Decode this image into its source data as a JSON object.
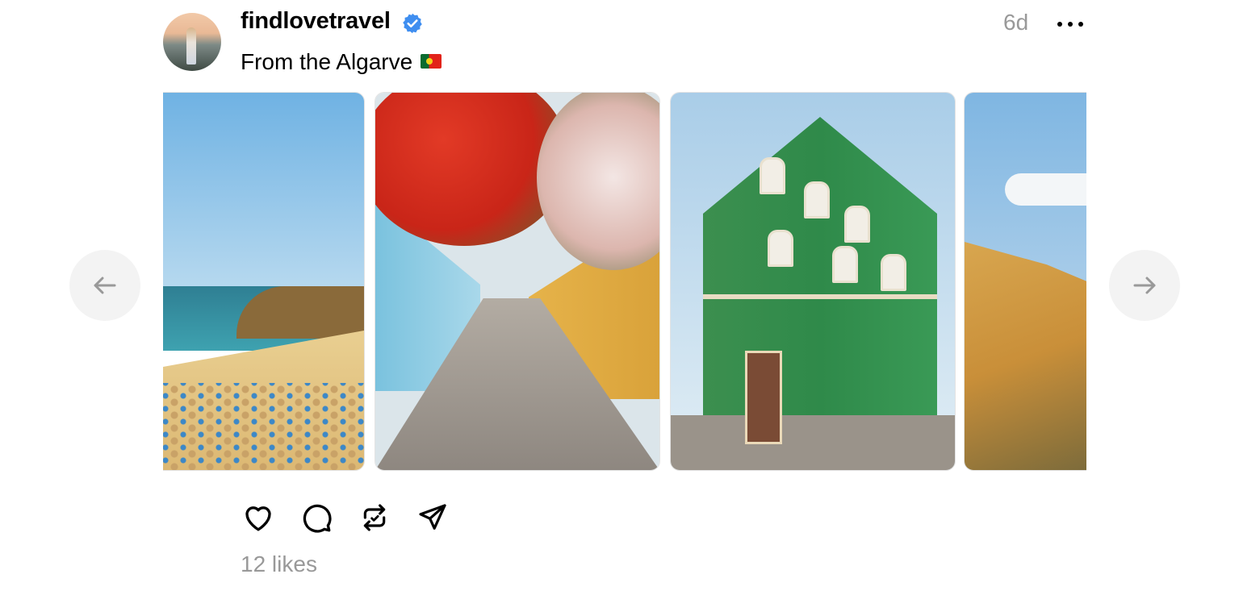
{
  "post": {
    "username": "findlovetravel",
    "verified": true,
    "time_ago": "6d",
    "caption": "From the Algarve",
    "caption_emoji": "portugal-flag",
    "likes_text": "12 likes"
  },
  "carousel": {
    "images": [
      {
        "subject": "beach-with-umbrellas-icon"
      },
      {
        "subject": "flowered-cobblestone-street-icon"
      },
      {
        "subject": "green-tiled-building-icon"
      },
      {
        "subject": "golden-cliffs-icon"
      }
    ],
    "prev_icon": "arrow-left-icon",
    "next_icon": "arrow-right-icon"
  },
  "actions": [
    {
      "name": "like",
      "icon": "heart-icon"
    },
    {
      "name": "comment",
      "icon": "comment-icon"
    },
    {
      "name": "repost",
      "icon": "repost-icon"
    },
    {
      "name": "share",
      "icon": "send-icon"
    }
  ],
  "colors": {
    "text": "#000000",
    "muted": "#999999",
    "verified_badge": "#3f8ef0",
    "nav_bg": "#f3f3f3"
  }
}
